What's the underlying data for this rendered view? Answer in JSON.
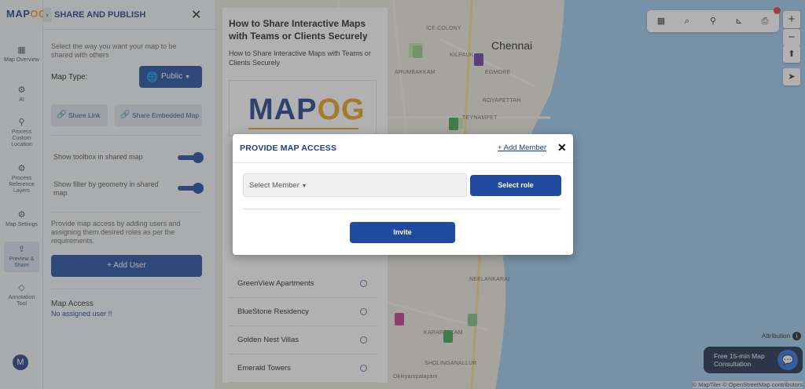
{
  "app": {
    "logo_main": "MAP",
    "logo_accent": "OG"
  },
  "rail": {
    "items": [
      {
        "label": "Map Overview",
        "icon": "map-icon"
      },
      {
        "label": "AI",
        "icon": "ai-gear-icon"
      },
      {
        "label": "Process Custom Location",
        "icon": "location-pin-icon"
      },
      {
        "label": "Process Reference Layers",
        "icon": "gear-icon"
      },
      {
        "label": "Map Settings",
        "icon": "settings-icon"
      },
      {
        "label": "Preview & Share",
        "icon": "share-icon"
      },
      {
        "label": "Annotation Tool",
        "icon": "paint-bucket-icon"
      }
    ],
    "avatar_letter": "M"
  },
  "share_panel": {
    "title": "SHARE AND PUBLISH",
    "intro": "Select the way you want your map to be shared with others",
    "map_type_label": "Map Type:",
    "map_type_value": "Public",
    "share_link": "Share Link",
    "share_embedded": "Share Embedded Map",
    "toggle_toolbox": "Show toolbox in shared map",
    "toggle_filter": "Show filter by geometry in shared map",
    "access_help": "Provide map access by adding users and assigning them desired roles as per the requirements.",
    "add_user": "+ Add User",
    "map_access_title": "Map Access",
    "no_assigned": "No assigned user !!"
  },
  "article": {
    "title": "How to Share Interactive Maps with Teams or Clients Securely",
    "subtitle": "How to Share Interactive Maps with Teams or Clients Securely",
    "logo_main": "MAP",
    "logo_accent": "OG",
    "list": [
      "GreenView Apartments",
      "BlueStone Residency",
      "Golden Nest Villas",
      "Emerald Towers"
    ]
  },
  "map": {
    "city": "Chennai",
    "labels": [
      "ICF COLONY",
      "KILPAUK",
      "EGMORE",
      "ARUMBAKKAM",
      "ROYAPETTAH",
      "TEYNAMPET",
      "NEELANKARAI",
      "SHOLINGANALLUR",
      "KARAPAKKAM",
      "Okkiyampalayam"
    ],
    "attribution": "Attribution",
    "footer_attribution": "© MapTiler © OpenStreetMap contributors",
    "consult_line1": "Free 15-min Map",
    "consult_line2": "Consultation",
    "accent_color": "#1f4aa0",
    "sea_color": "#9cc8ee"
  },
  "modal": {
    "title": "PROVIDE MAP ACCESS",
    "add_member": "+ Add Member",
    "select_member_placeholder": "Select Member",
    "select_role": "Select role",
    "invite": "Invite"
  }
}
